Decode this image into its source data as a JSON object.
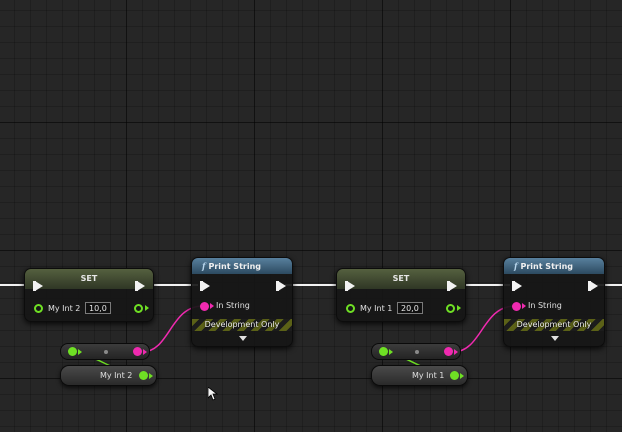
{
  "colors": {
    "exec": "#f2f2f2",
    "int_pin": "#6fe024",
    "string_pin": "#f02ab0",
    "set_header": "#55603f",
    "function_header": "#58809e"
  },
  "graph": {
    "group_a": {
      "set_node": {
        "title": "SET",
        "variable_label": "My Int 2",
        "value": "10,0"
      },
      "print_node": {
        "icon": "f",
        "title": "Print String",
        "in_string_label": "In String",
        "dev_label": "Development Only"
      },
      "conversion_node": {},
      "variable_node": {
        "label": "My Int 2"
      }
    },
    "group_b": {
      "set_node": {
        "title": "SET",
        "variable_label": "My Int 1",
        "value": "20,0"
      },
      "print_node": {
        "icon": "f",
        "title": "Print String",
        "in_string_label": "In String",
        "dev_label": "Development Only"
      },
      "conversion_node": {},
      "variable_node": {
        "label": "My Int 1"
      }
    }
  }
}
